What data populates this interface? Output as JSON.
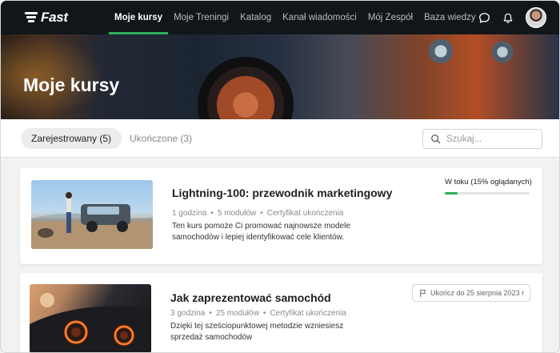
{
  "nav": {
    "brand": "Fast",
    "items": [
      {
        "label": "Moje kursy",
        "active": true
      },
      {
        "label": "Moje Treningi",
        "active": false
      },
      {
        "label": "Katalog",
        "active": false
      },
      {
        "label": "Kanał wiadomości",
        "active": false
      },
      {
        "label": "Mój Zespół",
        "active": false
      },
      {
        "label": "Baza wiedzy",
        "active": false
      }
    ],
    "icons": [
      "chat-icon",
      "bell-icon"
    ]
  },
  "hero": {
    "title": "Moje kursy"
  },
  "tabs": [
    {
      "label": "Zarejestrowany (5)",
      "active": true
    },
    {
      "label": "Ukończone (3)",
      "active": false
    }
  ],
  "search": {
    "placeholder": "Szukaj..."
  },
  "courses": [
    {
      "title": "Lightning-100: przewodnik marketingowy",
      "duration": "1 godzina",
      "modules": "5 modułów",
      "certificate": "Certyfikat ukończenia",
      "description": "Ten kurs pomoże Ci promować najnowsze modele samochodów i lepiej identyfikować cele klientów.",
      "status": "W toku (15% oglądanych)",
      "progress": 0.15
    },
    {
      "title": "Jak zaprezentować samochód",
      "duration": "3 godzina",
      "modules": "25 modułów",
      "certificate": "Certyfikat ukończenia",
      "description": "Dzięki tej sześciopunktowej metodzie wzniesiesz sprzedaż samochodów",
      "due": "Ukończ do 25 sierpnia 2023 r"
    }
  ],
  "colors": {
    "accent": "#2fae5a",
    "nav_bg": "#10161a"
  }
}
